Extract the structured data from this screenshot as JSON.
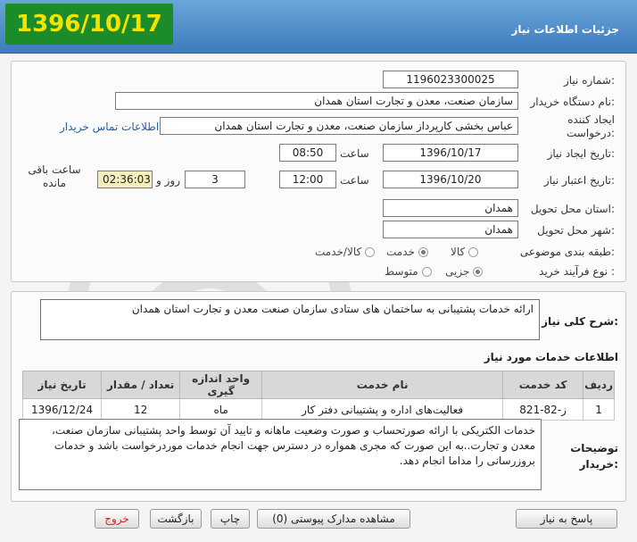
{
  "header": {
    "title": "جزئیات اطلاعات نیاز",
    "big_date": "1396/10/17"
  },
  "form": {
    "need_number_label": "شماره نیاز:",
    "need_number": "1196023300025",
    "buyer_org_label": "نام دستگاه خریدار:",
    "buyer_org": "سازمان صنعت، معدن و تجارت استان همدان",
    "creator_label": "ایجاد کننده درخواست:",
    "creator": "عباس بخشی کارپرداز سازمان صنعت، معدن و تجارت استان همدان",
    "contact_link": "اطلاعات تماس خریدار",
    "created_date_label": "تاریخ ایجاد نیاز:",
    "created_date": "1396/10/17",
    "time_label": "ساعت",
    "created_time": "08:50",
    "valid_date_label": "تاریخ اعتبار نیاز:",
    "valid_date": "1396/10/20",
    "valid_time": "12:00",
    "days": "3",
    "day_and_label": "روز و",
    "remaining_time": "02:36:03",
    "remaining_label": "ساعت باقی مانده",
    "province_label": "استان محل تحویل:",
    "province": "همدان",
    "city_label": "شهر محل تحویل:",
    "city": "همدان",
    "category_label": "طبقه بندی موضوعی:",
    "category_options": [
      "کالا",
      "خدمت",
      "کالا/خدمت"
    ],
    "category_selected": "خدمت",
    "purchase_type_label": "نوع فرآیند خرید :",
    "purchase_options": [
      "جزیی",
      "متوسط"
    ],
    "purchase_selected": "جزیی"
  },
  "description": {
    "label": "شرح کلی نیاز:",
    "text": "ارائه خدمات پشتیبانی به ساختمان های ستادی سازمان صنعت معدن و تجارت استان همدان"
  },
  "services": {
    "heading": "اطلاعات خدمات مورد نیاز",
    "columns": [
      "ردیف",
      "کد خدمت",
      "نام خدمت",
      "واحد اندازه گیری",
      "تعداد / مقدار",
      "تاریخ نیاز"
    ],
    "rows": [
      [
        "1",
        "ز-82-821",
        "فعالیت‌های اداره و پشتیبانی دفتر کار",
        "ماه",
        "12",
        "1396/12/24"
      ]
    ]
  },
  "buyer_notes": {
    "label": "توضیحات خریدار:",
    "text": "خدمات الکتریکی با ارائه صورتحساب و صورت وضعیت ماهانه و تایید آن توسط واحد پشتیبانی سازمان صنعت، معدن و تجارت..به این صورت که مجری همواره در دسترس جهت انجام خدمات موردرخواست باشد و خدمات بروزرسانی را مداما انجام دهد."
  },
  "buttons": {
    "reply": "پاسخ به نیاز",
    "attachments": "مشاهده مدارک پیوستی (0)",
    "print": "چاپ",
    "back": "بازگشت",
    "exit": "خروج"
  },
  "colors": {
    "header_blue": "#3e7bbf",
    "date_badge_bg": "#1c8b2a",
    "date_badge_fg": "#f3e300",
    "link_blue": "#1d5fb0",
    "exit_red": "#d02020"
  }
}
